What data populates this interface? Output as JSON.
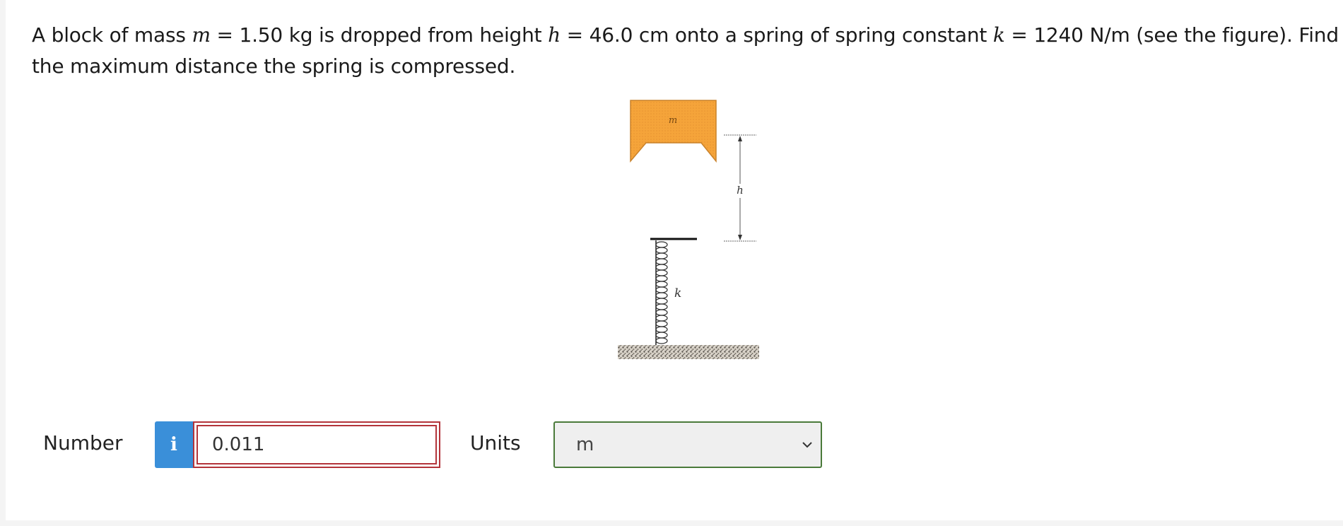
{
  "question": {
    "part1": "A block of mass ",
    "var_m": "m",
    "part2": " = 1.50 kg is dropped from height ",
    "var_h": "h",
    "part3": " = 46.0 cm onto a spring of spring constant ",
    "var_k": "k",
    "part4": " = 1240 N/m (see the figure). Find the maximum distance the spring is compressed."
  },
  "figure": {
    "block_label": "m",
    "height_label": "h",
    "spring_label": "k",
    "block_color": "#f5a43a",
    "ground_color": "#b8b0a4"
  },
  "answer": {
    "number_label": "Number",
    "info_icon": "i",
    "number_value": "0.011",
    "units_label": "Units",
    "units_value": "m",
    "number_border_color": "#b3343a",
    "units_border_color": "#4a7a3a",
    "info_color": "#3a8fd9"
  }
}
